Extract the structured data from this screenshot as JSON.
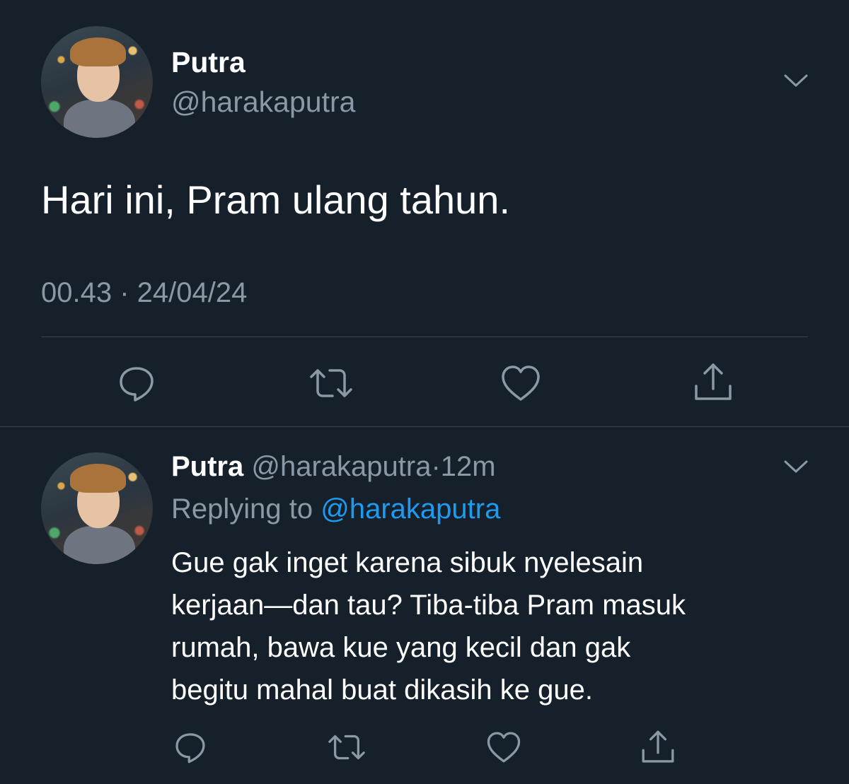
{
  "main_tweet": {
    "author_name": "Putra",
    "author_handle": "@harakaputra",
    "text": "Hari ini, Pram ulang tahun.",
    "timestamp": "00.43 · 24/04/24",
    "menu_icon": "chevron-down-icon",
    "actions": {
      "reply_icon": "reply-icon",
      "retweet_icon": "retweet-icon",
      "like_icon": "heart-icon",
      "share_icon": "share-icon"
    }
  },
  "reply_tweet": {
    "author_name": "Putra",
    "author_handle": "@harakaputra",
    "separator": "·",
    "time": "12m",
    "replying_label": "Replying to",
    "replying_to": "@harakaputra",
    "text_lines": [
      "Gue gak inget karena sibuk nyelesain",
      "kerjaan—dan tau? Tiba-tiba Pram masuk",
      "rumah, bawa kue yang kecil dan gak",
      "begitu mahal buat dikasih ke gue."
    ],
    "menu_icon": "chevron-down-icon",
    "actions": {
      "reply_icon": "reply-icon",
      "retweet_icon": "retweet-icon",
      "like_icon": "heart-icon",
      "share_icon": "share-icon"
    }
  },
  "colors": {
    "background": "#15202b",
    "primary_text": "#ffffff",
    "secondary_text": "#8b98a5",
    "link": "#1d9bf0",
    "divider": "#38444d"
  }
}
